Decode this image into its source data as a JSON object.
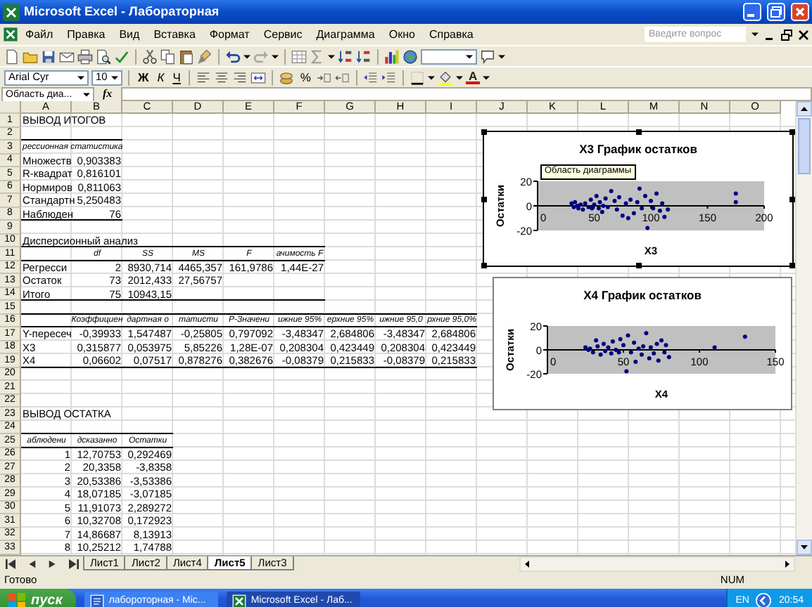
{
  "window": {
    "title": "Microsoft Excel - Лабораторная"
  },
  "menu": {
    "items": [
      "Файл",
      "Правка",
      "Вид",
      "Вставка",
      "Формат",
      "Сервис",
      "Диаграмма",
      "Окно",
      "Справка"
    ],
    "help_search": {
      "placeholder": "Введите вопрос"
    }
  },
  "formatting_toolbar": {
    "font": "Arial Cyr",
    "size": "10",
    "bold": "Ж",
    "italic": "К",
    "underline": "Ч",
    "percent": "%",
    "font_color": "A"
  },
  "formula_bar": {
    "name_box": "Область диа...",
    "fx": "fx"
  },
  "columns": [
    "A",
    "B",
    "C",
    "D",
    "E",
    "F",
    "G",
    "H",
    "I",
    "J",
    "K",
    "L",
    "M",
    "N",
    "O"
  ],
  "rows": [
    {
      "number": "1",
      "cells": [
        {
          "text": "ВЫВОД ИТОГОВ"
        }
      ]
    },
    {
      "number": "2",
      "rule_below": true,
      "cells": [
        null,
        null
      ]
    },
    {
      "number": "3",
      "italic": true,
      "cells": [
        {
          "text": "рессионная статистика"
        }
      ]
    },
    {
      "number": "4",
      "cells": [
        {
          "text": "Множеств"
        },
        {
          "text": "0,903383",
          "kind": "number"
        }
      ]
    },
    {
      "number": "5",
      "cells": [
        {
          "text": "R-квадрат"
        },
        {
          "text": "0,816101",
          "kind": "number"
        }
      ]
    },
    {
      "number": "6",
      "cells": [
        {
          "text": "Нормиров"
        },
        {
          "text": "0,811063",
          "kind": "number"
        }
      ]
    },
    {
      "number": "7",
      "cells": [
        {
          "text": "Стандартн"
        },
        {
          "text": "5,250483",
          "kind": "number"
        }
      ]
    },
    {
      "number": "8",
      "rule_below": true,
      "cells": [
        {
          "text": "Наблюден"
        },
        {
          "text": "76",
          "kind": "number"
        }
      ]
    },
    {
      "number": "9"
    },
    {
      "number": "10",
      "rule_below": true,
      "cells": [
        {
          "text": "Дисперсионный анализ"
        },
        null,
        null,
        null,
        null,
        null
      ]
    },
    {
      "number": "11",
      "italic": true,
      "rule_below": true,
      "cells": [
        null,
        {
          "text": "df",
          "kind": "heading"
        },
        {
          "text": "SS",
          "kind": "heading"
        },
        {
          "text": "MS",
          "kind": "heading"
        },
        {
          "text": "F",
          "kind": "heading"
        },
        {
          "text": "ачимость F",
          "kind": "heading"
        }
      ]
    },
    {
      "number": "12",
      "cells": [
        {
          "text": "Регресси"
        },
        {
          "text": "2",
          "kind": "number"
        },
        {
          "text": "8930,714",
          "kind": "number"
        },
        {
          "text": "4465,357",
          "kind": "number"
        },
        {
          "text": "161,9786",
          "kind": "number"
        },
        {
          "text": "1,44E-27",
          "kind": "number"
        }
      ]
    },
    {
      "number": "13",
      "cells": [
        {
          "text": "Остаток"
        },
        {
          "text": "73",
          "kind": "number"
        },
        {
          "text": "2012,433",
          "kind": "number"
        },
        {
          "text": "27,56757",
          "kind": "number"
        }
      ]
    },
    {
      "number": "14",
      "rule_below": true,
      "cells": [
        {
          "text": "Итого"
        },
        {
          "text": "75",
          "kind": "number"
        },
        {
          "text": "10943,15",
          "kind": "number"
        },
        null,
        null,
        null
      ]
    },
    {
      "number": "15",
      "rule_below": true,
      "cells": [
        null,
        null,
        null,
        null,
        null,
        null,
        null,
        null,
        null
      ]
    },
    {
      "number": "16",
      "italic": true,
      "rule_below": true,
      "cells": [
        null,
        {
          "text": "Коэффициен",
          "kind": "heading"
        },
        {
          "text": "дартная о",
          "kind": "heading"
        },
        {
          "text": "татисти",
          "kind": "heading"
        },
        {
          "text": "Р-Значени",
          "kind": "heading"
        },
        {
          "text": "ижние 95%",
          "kind": "heading"
        },
        {
          "text": "ерхние 95%",
          "kind": "heading"
        },
        {
          "text": "ижние 95,0",
          "kind": "heading"
        },
        {
          "text": "рхние 95,0%",
          "kind": "heading"
        }
      ]
    },
    {
      "number": "17",
      "cells": [
        {
          "text": "Y-пересеч"
        },
        {
          "text": "-0,39933",
          "kind": "number"
        },
        {
          "text": "1,547487",
          "kind": "number"
        },
        {
          "text": "-0,25805",
          "kind": "number"
        },
        {
          "text": "0,797092",
          "kind": "number"
        },
        {
          "text": "-3,48347",
          "kind": "number"
        },
        {
          "text": "2,684806",
          "kind": "number"
        },
        {
          "text": "-3,48347",
          "kind": "number"
        },
        {
          "text": "2,684806",
          "kind": "number"
        }
      ]
    },
    {
      "number": "18",
      "cells": [
        {
          "text": "X3"
        },
        {
          "text": "0,315877",
          "kind": "number"
        },
        {
          "text": "0,053975",
          "kind": "number"
        },
        {
          "text": "5,85226",
          "kind": "number"
        },
        {
          "text": "1,28E-07",
          "kind": "number"
        },
        {
          "text": "0,208304",
          "kind": "number"
        },
        {
          "text": "0,423449",
          "kind": "number"
        },
        {
          "text": "0,208304",
          "kind": "number"
        },
        {
          "text": "0,423449",
          "kind": "number"
        }
      ]
    },
    {
      "number": "19",
      "rule_below": true,
      "cells": [
        {
          "text": "X4"
        },
        {
          "text": "0,06602",
          "kind": "number"
        },
        {
          "text": "0,07517",
          "kind": "number"
        },
        {
          "text": "0,878276",
          "kind": "number"
        },
        {
          "text": "0,382676",
          "kind": "number"
        },
        {
          "text": "-0,08379",
          "kind": "number"
        },
        {
          "text": "0,215833",
          "kind": "number"
        },
        {
          "text": "-0,08379",
          "kind": "number"
        },
        {
          "text": "0,215833",
          "kind": "number"
        }
      ]
    },
    {
      "number": "20"
    },
    {
      "number": "21"
    },
    {
      "number": "22"
    },
    {
      "number": "23",
      "cells": [
        {
          "text": "ВЫВОД ОСТАТКА"
        }
      ]
    },
    {
      "number": "24",
      "rule_below": true,
      "cells": [
        null,
        null,
        null
      ]
    },
    {
      "number": "25",
      "italic": true,
      "rule_below": true,
      "cells": [
        {
          "text": "аблюдени",
          "kind": "heading"
        },
        {
          "text": "дсказанно",
          "kind": "heading"
        },
        {
          "text": "Остатки",
          "kind": "heading"
        }
      ]
    },
    {
      "number": "26",
      "cells": [
        {
          "text": "1",
          "kind": "number"
        },
        {
          "text": "12,70753",
          "kind": "number"
        },
        {
          "text": "0,292469",
          "kind": "number"
        }
      ]
    },
    {
      "number": "27",
      "cells": [
        {
          "text": "2",
          "kind": "number"
        },
        {
          "text": "20,3358",
          "kind": "number"
        },
        {
          "text": "-3,8358",
          "kind": "number"
        }
      ]
    },
    {
      "number": "28",
      "cells": [
        {
          "text": "3",
          "kind": "number"
        },
        {
          "text": "20,53386",
          "kind": "number"
        },
        {
          "text": "-3,53386",
          "kind": "number"
        }
      ]
    },
    {
      "number": "29",
      "cells": [
        {
          "text": "4",
          "kind": "number"
        },
        {
          "text": "18,07185",
          "kind": "number"
        },
        {
          "text": "-3,07185",
          "kind": "number"
        }
      ]
    },
    {
      "number": "30",
      "cells": [
        {
          "text": "5",
          "kind": "number"
        },
        {
          "text": "11,91073",
          "kind": "number"
        },
        {
          "text": "2,289272",
          "kind": "number"
        }
      ]
    },
    {
      "number": "31",
      "cells": [
        {
          "text": "6",
          "kind": "number"
        },
        {
          "text": "10,32708",
          "kind": "number"
        },
        {
          "text": "0,172923",
          "kind": "number"
        }
      ]
    },
    {
      "number": "32",
      "cells": [
        {
          "text": "7",
          "kind": "number"
        },
        {
          "text": "14,86687",
          "kind": "number"
        },
        {
          "text": "8,13913",
          "kind": "number"
        }
      ]
    },
    {
      "number": "33",
      "cells": [
        {
          "text": "8",
          "kind": "number"
        },
        {
          "text": "10,25212",
          "kind": "number"
        },
        {
          "text": "1,74788",
          "kind": "number"
        }
      ]
    }
  ],
  "charts": [
    {
      "selected": true,
      "tooltip": "Область диаграммы",
      "chart_data": {
        "type": "scatter",
        "title": "X3 График остатков",
        "xlabel": "X3",
        "ylabel": "Остатки",
        "xlim": [
          0,
          200
        ],
        "ylim": [
          -20,
          20
        ],
        "xticks": [
          0,
          50,
          100,
          150,
          200
        ],
        "yticks": [
          -20,
          0,
          20
        ],
        "x": [
          30,
          32,
          33,
          35,
          36,
          38,
          40,
          42,
          45,
          47,
          48,
          50,
          52,
          54,
          55,
          57,
          58,
          60,
          62,
          65,
          68,
          70,
          72,
          75,
          78,
          80,
          82,
          85,
          88,
          90,
          92,
          95,
          97,
          100,
          102,
          105,
          108,
          110,
          112,
          115,
          175,
          175
        ],
        "series": [
          {
            "color": "#000080",
            "values": [
              2,
              -1,
              3,
              0,
              -2,
              1,
              -3,
              2,
              -1,
              5,
              -2,
              1,
              8,
              -2,
              3,
              -5,
              0,
              6,
              -1,
              12,
              4,
              -3,
              7,
              -8,
              2,
              -10,
              5,
              -6,
              3,
              14,
              -2,
              8,
              -18,
              4,
              -2,
              10,
              -4,
              2,
              -9,
              -3,
              10,
              3
            ]
          }
        ]
      }
    },
    {
      "selected": false,
      "chart_data": {
        "type": "scatter",
        "title": "X4 График остатков",
        "xlabel": "X4",
        "ylabel": "Остатки",
        "xlim": [
          0,
          150
        ],
        "ylim": [
          -20,
          20
        ],
        "xticks": [
          0,
          50,
          100,
          150
        ],
        "yticks": [
          -20,
          0,
          20
        ],
        "x": [
          25,
          27,
          28,
          30,
          32,
          33,
          35,
          37,
          38,
          40,
          42,
          43,
          45,
          47,
          48,
          50,
          52,
          53,
          55,
          57,
          58,
          60,
          62,
          63,
          65,
          67,
          68,
          70,
          72,
          73,
          75,
          77,
          78,
          80,
          110,
          130
        ],
        "series": [
          {
            "color": "#000080",
            "values": [
              2,
              0,
              1,
              -2,
              8,
              3,
              -4,
              5,
              -1,
              2,
              -3,
              7,
              0,
              -2,
              9,
              4,
              -18,
              12,
              -2,
              6,
              -10,
              1,
              -4,
              3,
              14,
              -7,
              2,
              -3,
              5,
              -9,
              8,
              -2,
              4,
              -6,
              2,
              11
            ]
          }
        ]
      }
    }
  ],
  "sheet_tabs": [
    {
      "label": "Лист1",
      "selected": false
    },
    {
      "label": "Лист2",
      "selected": false
    },
    {
      "label": "Лист4",
      "selected": false
    },
    {
      "label": "Лист5",
      "selected": true
    },
    {
      "label": "Лист3",
      "selected": false
    }
  ],
  "status_bar": {
    "text": "Готово",
    "num": "NUM"
  },
  "taskbar": {
    "start": "пуск",
    "tasks": [
      {
        "label": "лабороторная - Mic...",
        "kind": "word",
        "selected": false
      },
      {
        "label": "Microsoft Excel - Лаб...",
        "kind": "excel",
        "selected": true
      }
    ],
    "language": "EN",
    "clock": "20:54"
  }
}
